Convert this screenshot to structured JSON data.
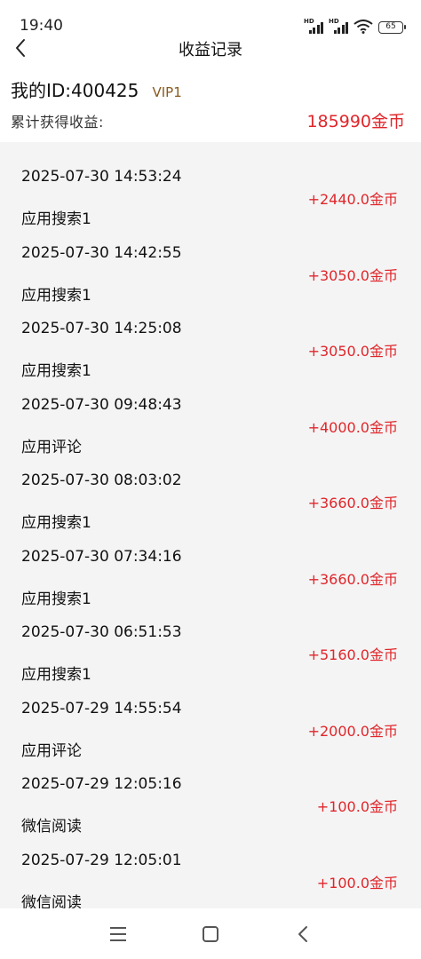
{
  "status_bar": {
    "time": "19:40",
    "signal_label": "HD",
    "battery": "65"
  },
  "header": {
    "title": "收益记录"
  },
  "user": {
    "id_text": "我的ID:400425",
    "vip": "VIP1"
  },
  "summary": {
    "label": "累计获得收益:",
    "value": "185990金币"
  },
  "records": [
    {
      "time": "2025-07-30 14:53:24",
      "type": "应用搜索1",
      "amount": "+2440.0金币"
    },
    {
      "time": "2025-07-30 14:42:55",
      "type": "应用搜索1",
      "amount": "+3050.0金币"
    },
    {
      "time": "2025-07-30 14:25:08",
      "type": "应用搜索1",
      "amount": "+3050.0金币"
    },
    {
      "time": "2025-07-30 09:48:43",
      "type": "应用评论",
      "amount": "+4000.0金币"
    },
    {
      "time": "2025-07-30 08:03:02",
      "type": "应用搜索1",
      "amount": "+3660.0金币"
    },
    {
      "time": "2025-07-30 07:34:16",
      "type": "应用搜索1",
      "amount": "+3660.0金币"
    },
    {
      "time": "2025-07-30 06:51:53",
      "type": "应用搜索1",
      "amount": "+5160.0金币"
    },
    {
      "time": "2025-07-29 14:55:54",
      "type": "应用评论",
      "amount": "+2000.0金币"
    },
    {
      "time": "2025-07-29 12:05:16",
      "type": "微信阅读",
      "amount": "+100.0金币"
    },
    {
      "time": "2025-07-29 12:05:01",
      "type": "微信阅读",
      "amount": "+100.0金币"
    }
  ],
  "colors": {
    "accent_red": "#e0262b",
    "vip_brown": "#8a5a1e",
    "list_bg": "#f4f4f4"
  },
  "icons": {
    "back": "chevron-left-icon",
    "menu": "menu-icon",
    "home": "square-home-icon",
    "nav_back": "nav-back-icon"
  }
}
